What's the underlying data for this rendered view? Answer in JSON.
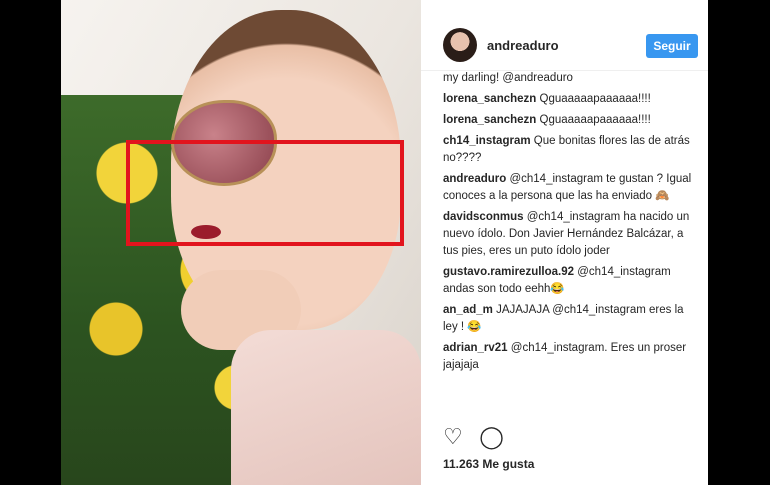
{
  "post": {
    "username": "andreaduro",
    "follow_label": "Seguir",
    "likes": "11.263 Me gusta"
  },
  "comments": [
    {
      "user": "",
      "text": "my darling! @andreaduro"
    },
    {
      "user": "lorena_sanchezn",
      "text": "Qguaaaaapaaaaaa!!!!"
    },
    {
      "user": "lorena_sanchezn",
      "text": "Qguaaaaapaaaaaa!!!!"
    },
    {
      "user": "ch14_instagram",
      "text": "Que bonitas flores las de atrás no????"
    },
    {
      "user": "andreaduro",
      "text": "@ch14_instagram te gustan ? Igual conoces a la persona que las ha enviado 🙈"
    },
    {
      "user": "davidsconmus",
      "text": "@ch14_instagram ha nacido un nuevo ídolo. Don Javier Hernández Balcázar, a tus pies, eres un puto ídolo joder"
    },
    {
      "user": "gustavo.ramirezulloa.92",
      "text": "@ch14_instagram andas son todo eehh😂"
    },
    {
      "user": "an_ad_m",
      "text": "JAJAJAJA @ch14_instagram eres la ley ! 😂"
    },
    {
      "user": "adrian_rv21",
      "text": "@ch14_instagram. Eres un proser jajajaja"
    }
  ],
  "icons": {
    "heart": "♡",
    "comment": "◯"
  }
}
